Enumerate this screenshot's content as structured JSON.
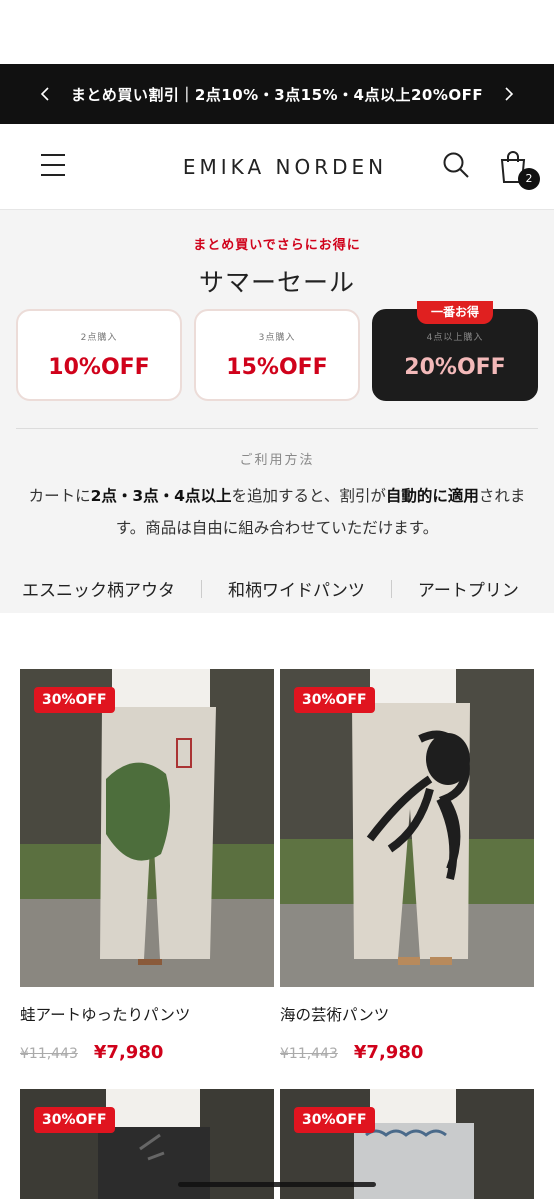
{
  "announcement": {
    "text": "まとめ買い割引｜2点10%・3点15%・4点以上20%OFF"
  },
  "header": {
    "brand": "EMIKA NORDEN",
    "cart_count": "2"
  },
  "promo": {
    "kicker": "まとめ買いでさらにお得に",
    "title": "サマーセール",
    "tiers": [
      {
        "qty": "2点購入",
        "off": "10%OFF"
      },
      {
        "qty": "3点購入",
        "off": "15%OFF"
      },
      {
        "qty": "4点以上購入",
        "off": "20%OFF",
        "ribbon": "一番お得"
      }
    ],
    "howto_label": "ご利用方法",
    "howto_text": {
      "p1": "カートに",
      "b1": "2点・3点・4点以上",
      "p2": "を追加すると、割引が",
      "b2": "自動的に適用",
      "p3": "されます。商品は自由に組み合わせていただけます。"
    }
  },
  "categories": [
    "エスニック柄アウタ",
    "和柄ワイドパンツ",
    "アートプリン"
  ],
  "products": [
    {
      "badge": "30%OFF",
      "name": "蛙アートゆったりパンツ",
      "old_price": "¥11,443",
      "price": "¥7,980",
      "icon": "frog-print-pants"
    },
    {
      "badge": "30%OFF",
      "name": "海の芸術パンツ",
      "old_price": "¥11,443",
      "price": "¥7,980",
      "icon": "octopus-print-pants"
    },
    {
      "badge": "30%OFF",
      "icon": "bamboo-print-pants"
    },
    {
      "badge": "30%OFF",
      "icon": "wave-print-pants"
    }
  ],
  "colors": {
    "accent": "#d0021b",
    "badge": "#e0141f",
    "dark": "#111111"
  }
}
